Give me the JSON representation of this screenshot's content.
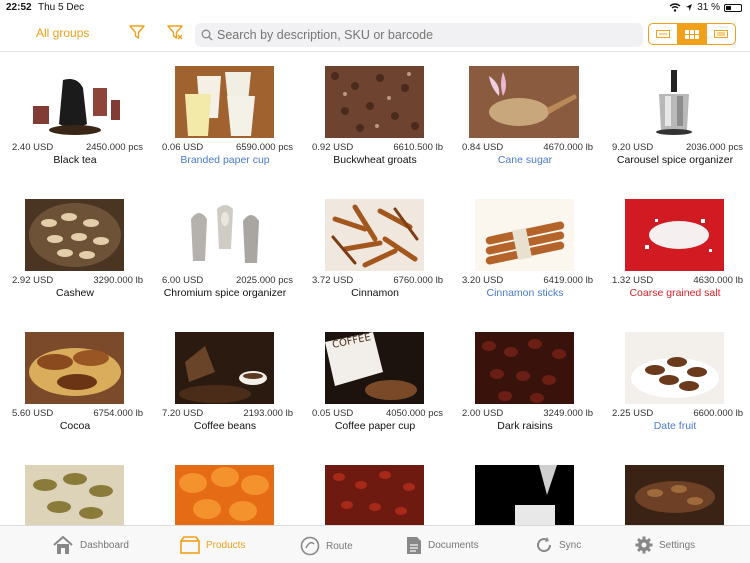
{
  "status": {
    "time": "22:52",
    "date": "Thu 5 Dec",
    "battery": "31 %"
  },
  "toolbar": {
    "groups_label": "All groups",
    "search_placeholder": "Search by description, SKU or barcode",
    "view_modes": [
      "list-view-icon",
      "grid-view-icon",
      "detail-view-icon"
    ],
    "active_view": 1,
    "accent_color": "#f0a019"
  },
  "products": [
    {
      "name": "Black tea",
      "price": "2.40 USD",
      "qty": "2450.000 pcs",
      "color": "normal"
    },
    {
      "name": "Branded paper cup",
      "price": "0.06 USD",
      "qty": "6590.000 pcs",
      "color": "blue"
    },
    {
      "name": "Buckwheat groats",
      "price": "0.92 USD",
      "qty": "6610.500 lb",
      "color": "normal"
    },
    {
      "name": "Cane sugar",
      "price": "0.84 USD",
      "qty": "4670.000 lb",
      "color": "blue"
    },
    {
      "name": "Carousel spice organizer",
      "price": "9.20 USD",
      "qty": "2036.000 pcs",
      "color": "normal"
    },
    {
      "name": "Cashew",
      "price": "2.92 USD",
      "qty": "3290.000 lb",
      "color": "normal"
    },
    {
      "name": "Chromium spice organizer",
      "price": "6.00 USD",
      "qty": "2025.000 pcs",
      "color": "normal"
    },
    {
      "name": "Cinnamon",
      "price": "3.72 USD",
      "qty": "6760.000 lb",
      "color": "normal"
    },
    {
      "name": "Cinnamon sticks",
      "price": "3.20 USD",
      "qty": "6419.000 lb",
      "color": "blue"
    },
    {
      "name": "Coarse grained salt",
      "price": "1.32 USD",
      "qty": "4630.000 lb",
      "color": "red"
    },
    {
      "name": "Cocoa",
      "price": "5.60 USD",
      "qty": "6754.000 lb",
      "color": "normal"
    },
    {
      "name": "Coffee beans",
      "price": "7.20 USD",
      "qty": "2193.000 lb",
      "color": "normal"
    },
    {
      "name": "Coffee paper cup",
      "price": "0.05 USD",
      "qty": "4050.000 pcs",
      "color": "normal"
    },
    {
      "name": "Dark raisins",
      "price": "2.00 USD",
      "qty": "3249.000 lb",
      "color": "normal"
    },
    {
      "name": "Date fruit",
      "price": "2.25 USD",
      "qty": "6600.000 lb",
      "color": "blue"
    }
  ],
  "tabs": [
    {
      "label": "Dashboard",
      "icon": "house-icon"
    },
    {
      "label": "Products",
      "icon": "box-icon"
    },
    {
      "label": "Route",
      "icon": "route-icon"
    },
    {
      "label": "Documents",
      "icon": "document-icon"
    },
    {
      "label": "Sync",
      "icon": "sync-icon"
    },
    {
      "label": "Settings",
      "icon": "gear-icon"
    }
  ],
  "active_tab": 1
}
